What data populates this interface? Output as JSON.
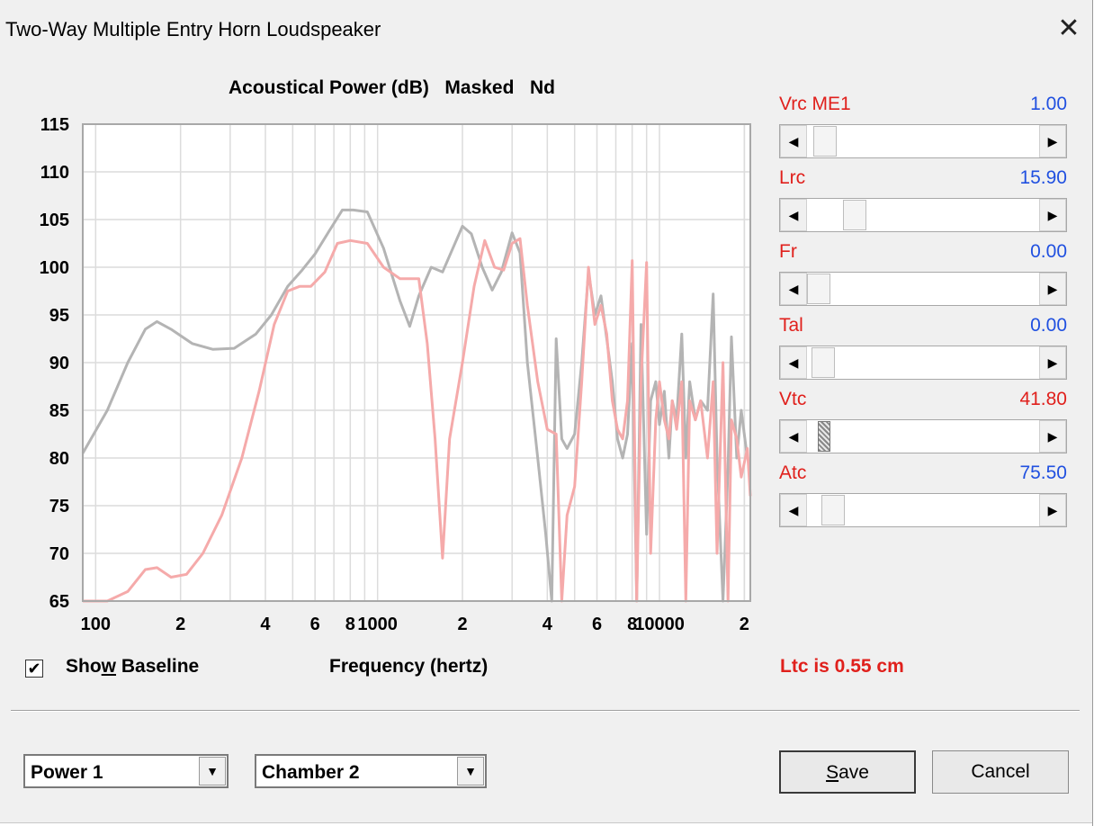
{
  "window": {
    "title": "Two-Way Multiple Entry Horn Loudspeaker",
    "close_glyph": "✕"
  },
  "chart_header": {
    "title": "Acoustical Power (dB)",
    "mode": "Masked",
    "tag": "Nd"
  },
  "chart_data": {
    "type": "line",
    "xscale": "log",
    "xlim": [
      90,
      21000
    ],
    "ylim": [
      65,
      115
    ],
    "yticks": [
      115,
      110,
      105,
      100,
      95,
      90,
      85,
      80,
      75,
      70,
      65
    ],
    "xtick_labels": [
      {
        "x": 100,
        "label": "100"
      },
      {
        "x": 200,
        "label": "2"
      },
      {
        "x": 400,
        "label": "4"
      },
      {
        "x": 600,
        "label": "6"
      },
      {
        "x": 800,
        "label": "8"
      },
      {
        "x": 1000,
        "label": "1000"
      },
      {
        "x": 2000,
        "label": "2"
      },
      {
        "x": 4000,
        "label": "4"
      },
      {
        "x": 6000,
        "label": "6"
      },
      {
        "x": 8000,
        "label": "8"
      },
      {
        "x": 10000,
        "label": "10000"
      },
      {
        "x": 20000,
        "label": "2"
      }
    ],
    "xlabel": "Frequency (hertz)",
    "grid": true,
    "series": [
      {
        "color": "#b4b4b4",
        "points": [
          [
            90,
            80.5
          ],
          [
            110,
            85
          ],
          [
            130,
            90
          ],
          [
            150,
            93.5
          ],
          [
            165,
            94.3
          ],
          [
            185,
            93.5
          ],
          [
            220,
            92
          ],
          [
            260,
            91.4
          ],
          [
            310,
            91.5
          ],
          [
            370,
            93
          ],
          [
            420,
            95
          ],
          [
            480,
            98
          ],
          [
            540,
            99.7
          ],
          [
            600,
            101.4
          ],
          [
            680,
            104
          ],
          [
            750,
            106
          ],
          [
            820,
            106
          ],
          [
            920,
            105.8
          ],
          [
            1050,
            102
          ],
          [
            1200,
            96.5
          ],
          [
            1300,
            93.8
          ],
          [
            1400,
            97
          ],
          [
            1550,
            100
          ],
          [
            1700,
            99.5
          ],
          [
            1850,
            102
          ],
          [
            2000,
            104.3
          ],
          [
            2150,
            103.5
          ],
          [
            2350,
            100
          ],
          [
            2550,
            97.6
          ],
          [
            2750,
            99.5
          ],
          [
            3000,
            103.6
          ],
          [
            3200,
            101.5
          ],
          [
            3400,
            90
          ],
          [
            3700,
            80
          ],
          [
            3950,
            72
          ],
          [
            4150,
            64
          ],
          [
            4300,
            92.5
          ],
          [
            4500,
            82
          ],
          [
            4700,
            81
          ],
          [
            5000,
            82.5
          ],
          [
            5300,
            90
          ],
          [
            5600,
            99.5
          ],
          [
            5900,
            95
          ],
          [
            6200,
            97
          ],
          [
            6500,
            92.5
          ],
          [
            6800,
            88
          ],
          [
            7100,
            82
          ],
          [
            7400,
            80
          ],
          [
            7700,
            82.5
          ],
          [
            8000,
            92
          ],
          [
            8300,
            64
          ],
          [
            8600,
            94
          ],
          [
            9000,
            72
          ],
          [
            9300,
            86
          ],
          [
            9700,
            88
          ],
          [
            10000,
            83.5
          ],
          [
            10400,
            87
          ],
          [
            10800,
            80
          ],
          [
            11100,
            86
          ],
          [
            11500,
            84
          ],
          [
            12000,
            93
          ],
          [
            12400,
            80
          ],
          [
            12800,
            88
          ],
          [
            13400,
            84
          ],
          [
            14000,
            86
          ],
          [
            14800,
            85
          ],
          [
            15500,
            97.2
          ],
          [
            16000,
            80
          ],
          [
            16800,
            64
          ],
          [
            17500,
            79
          ],
          [
            18000,
            92.7
          ],
          [
            18800,
            80
          ],
          [
            19500,
            85
          ],
          [
            20500,
            80
          ]
        ]
      },
      {
        "color": "#f5aaaa",
        "points": [
          [
            90,
            62
          ],
          [
            110,
            64
          ],
          [
            130,
            66
          ],
          [
            150,
            68.3
          ],
          [
            165,
            68.5
          ],
          [
            185,
            67.5
          ],
          [
            210,
            67.8
          ],
          [
            240,
            70
          ],
          [
            280,
            74
          ],
          [
            330,
            80
          ],
          [
            380,
            87
          ],
          [
            430,
            94
          ],
          [
            480,
            97.5
          ],
          [
            530,
            98
          ],
          [
            580,
            98
          ],
          [
            650,
            99.5
          ],
          [
            720,
            102.5
          ],
          [
            800,
            102.8
          ],
          [
            920,
            102.5
          ],
          [
            1050,
            100
          ],
          [
            1200,
            98.8
          ],
          [
            1400,
            98.8
          ],
          [
            1500,
            92
          ],
          [
            1600,
            82
          ],
          [
            1700,
            69.5
          ],
          [
            1800,
            82
          ],
          [
            2000,
            90
          ],
          [
            2200,
            98
          ],
          [
            2400,
            102.8
          ],
          [
            2600,
            100
          ],
          [
            2800,
            99.7
          ],
          [
            3000,
            102.5
          ],
          [
            3200,
            103
          ],
          [
            3400,
            96
          ],
          [
            3700,
            88
          ],
          [
            4000,
            83
          ],
          [
            4300,
            82.5
          ],
          [
            4500,
            64
          ],
          [
            4700,
            74
          ],
          [
            5000,
            77
          ],
          [
            5300,
            88
          ],
          [
            5600,
            100
          ],
          [
            5900,
            94
          ],
          [
            6200,
            96
          ],
          [
            6500,
            93
          ],
          [
            6800,
            86
          ],
          [
            7100,
            83
          ],
          [
            7400,
            82
          ],
          [
            7700,
            86
          ],
          [
            8000,
            100.7
          ],
          [
            8300,
            64
          ],
          [
            8600,
            88
          ],
          [
            9000,
            100.5
          ],
          [
            9300,
            70
          ],
          [
            9700,
            84
          ],
          [
            10000,
            88
          ],
          [
            10400,
            84
          ],
          [
            10800,
            82
          ],
          [
            11100,
            86
          ],
          [
            11500,
            83
          ],
          [
            12000,
            88
          ],
          [
            12400,
            64
          ],
          [
            12800,
            86
          ],
          [
            13400,
            84
          ],
          [
            14000,
            86
          ],
          [
            14800,
            80
          ],
          [
            15500,
            88
          ],
          [
            16000,
            70
          ],
          [
            16800,
            90
          ],
          [
            17500,
            64
          ],
          [
            18000,
            84
          ],
          [
            18800,
            82
          ],
          [
            19500,
            78
          ],
          [
            20500,
            81
          ],
          [
            21000,
            76
          ]
        ]
      }
    ]
  },
  "sliders": [
    {
      "label": "Vrc  ME1",
      "value": "1.00",
      "value_color": "#2050e0",
      "position": 0.03
    },
    {
      "label": "Lrc",
      "value": "15.90",
      "value_color": "#2050e0",
      "position": 0.17
    },
    {
      "label": "Fr",
      "value": "0.00",
      "value_color": "#2050e0",
      "position": 0.0
    },
    {
      "label": "Tal",
      "value": "0.00",
      "value_color": "#2050e0",
      "position": 0.02
    },
    {
      "label": "Vtc",
      "value": "41.80",
      "value_color": "#e0201c",
      "position": 0.05
    },
    {
      "label": "Atc",
      "value": "75.50",
      "value_color": "#2050e0",
      "position": 0.07
    }
  ],
  "checkbox": {
    "label_pre": "Sho",
    "label_u": "w",
    "label_post": " Baseline",
    "checked_glyph": "✔"
  },
  "status": {
    "ltc": "Ltc is 0.55 cm"
  },
  "combos": [
    {
      "value": "Power 1"
    },
    {
      "value": "Chamber 2"
    }
  ],
  "buttons": {
    "save_u": "S",
    "save_rest": "ave",
    "cancel": "Cancel"
  },
  "glyphs": {
    "left_arrow": "◀",
    "right_arrow": "▶",
    "down_arrow": "▼"
  },
  "colors": {
    "label_red": "#e0201c",
    "value_blue": "#2050e0",
    "baseline": "#b4b4b4",
    "response": "#f5aaaa"
  }
}
